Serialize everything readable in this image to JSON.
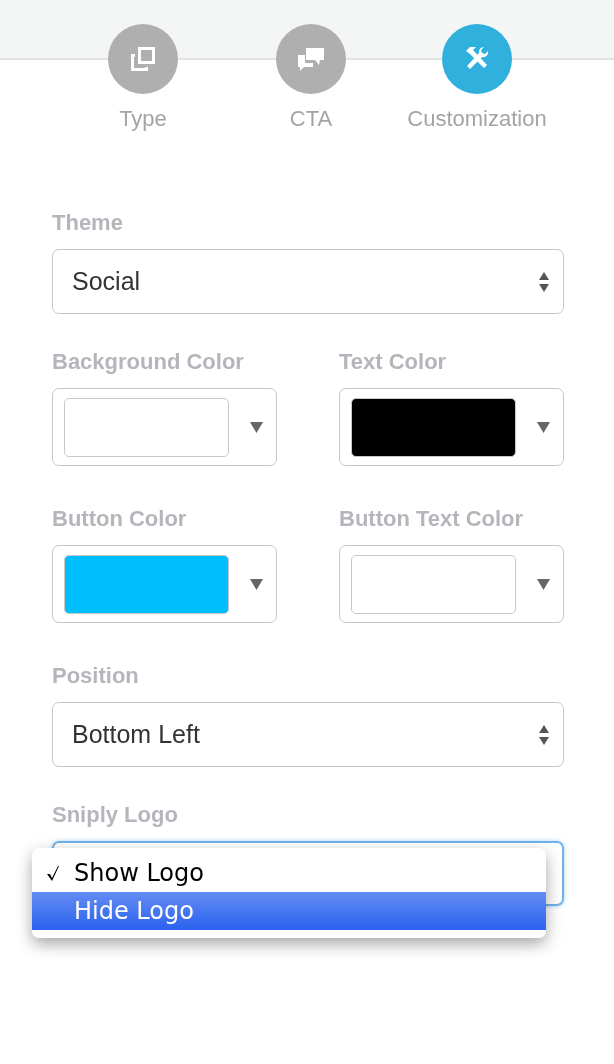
{
  "steps": [
    {
      "kind": "type",
      "label": "Type",
      "selected": false
    },
    {
      "kind": "cta",
      "label": "CTA",
      "selected": false
    },
    {
      "kind": "customization",
      "label": "Customization",
      "selected": true
    }
  ],
  "theme": {
    "label": "Theme",
    "value": "Social",
    "focused": false
  },
  "colors": [
    {
      "label": "Background Color",
      "color": "#ffffff"
    },
    {
      "label": "Text Color",
      "color": "#000000"
    },
    {
      "label": "Button Color",
      "color": "#00bfff"
    },
    {
      "label": "Button Text Color",
      "color": "#ffffff"
    }
  ],
  "position": {
    "label": "Position",
    "value": "Bottom Left",
    "focused": false
  },
  "logo": {
    "label": "Sniply Logo",
    "focused": true,
    "options": [
      {
        "label": "Show Logo",
        "checked": true,
        "selected": false
      },
      {
        "label": "Hide Logo",
        "checked": false,
        "selected": true
      }
    ]
  }
}
